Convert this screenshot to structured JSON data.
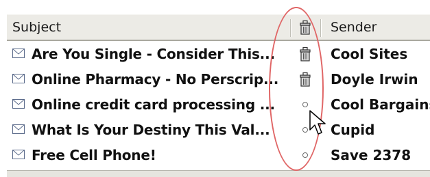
{
  "columns": {
    "subject": "Subject",
    "junk_icon": "junk-status-icon",
    "sender": "Sender"
  },
  "messages": [
    {
      "subject": "Are You Single - Consider This...",
      "sender": "Cool Sites",
      "status": "junk"
    },
    {
      "subject": "Online Pharmacy - No Perscrip...",
      "sender": "Doyle Irwin",
      "status": "junk"
    },
    {
      "subject": "Online credit card processing ...",
      "sender": "Cool Bargains",
      "status": "none"
    },
    {
      "subject": "What Is Your Destiny This Val...",
      "sender": "Cupid",
      "status": "none"
    },
    {
      "subject": "Free Cell Phone!",
      "sender": "Save 2378",
      "status": "none"
    }
  ],
  "colors": {
    "highlight": "#e06666",
    "header_bg": "#ecebe6"
  }
}
